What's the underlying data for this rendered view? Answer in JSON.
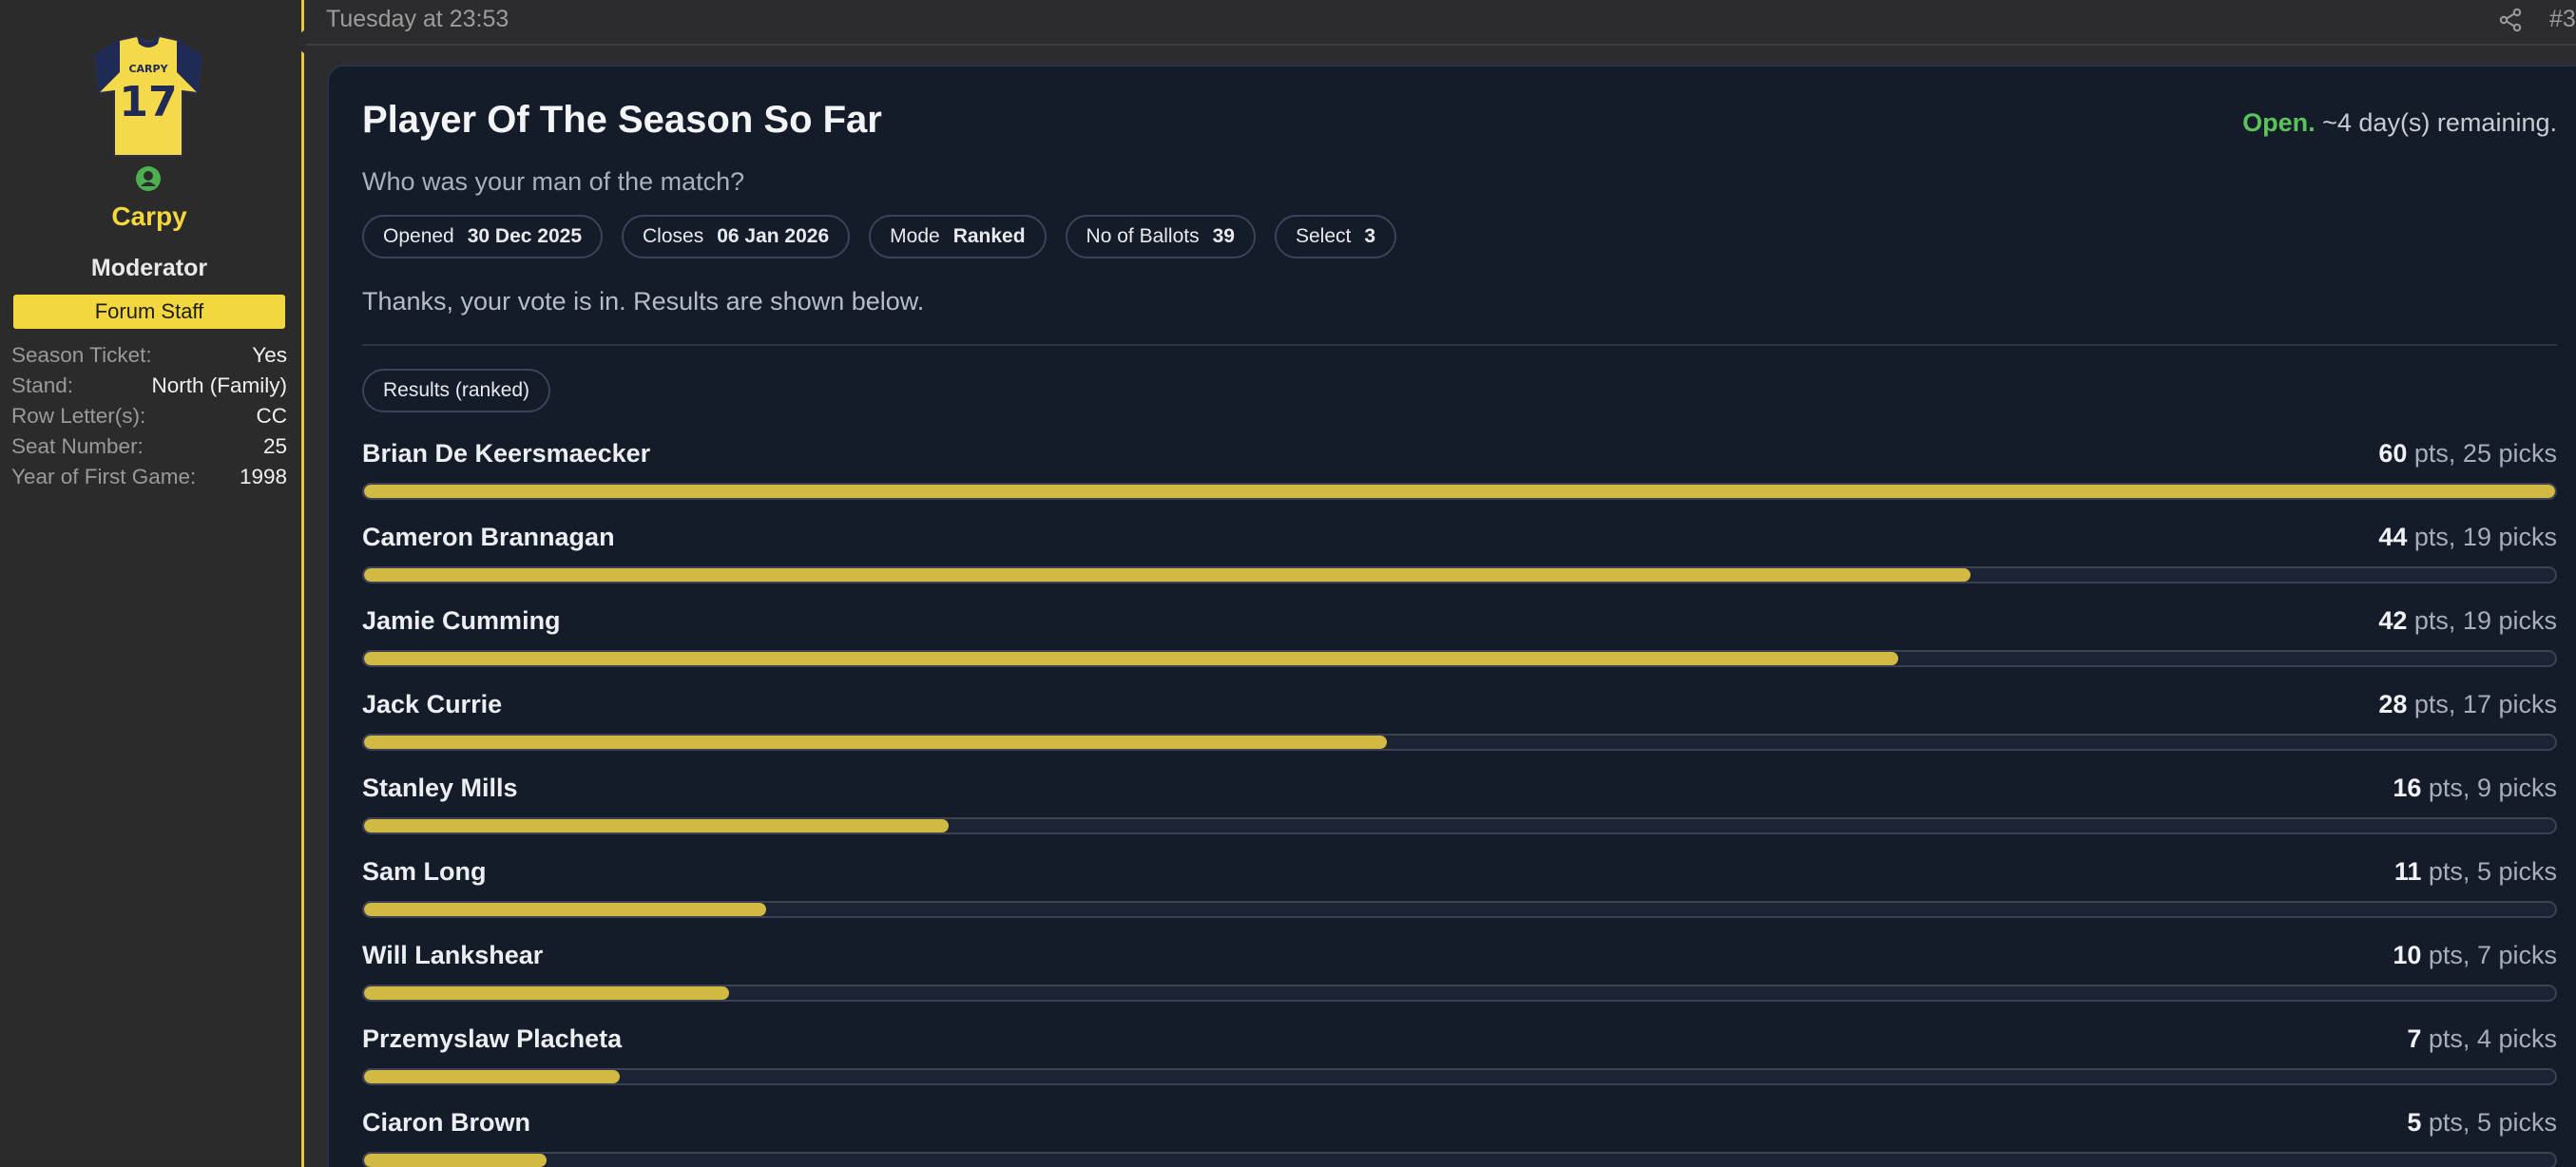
{
  "user": {
    "jersey_name": "CARPY",
    "jersey_number": "17",
    "name": "Carpy",
    "title": "Moderator",
    "banner": "Forum Staff",
    "fields": [
      {
        "label": "Season Ticket:",
        "value": "Yes"
      },
      {
        "label": "Stand:",
        "value": "North (Family)"
      },
      {
        "label": "Row Letter(s):",
        "value": "CC"
      },
      {
        "label": "Seat Number:",
        "value": "25"
      },
      {
        "label": "Year of First Game:",
        "value": "1998"
      }
    ]
  },
  "post": {
    "timestamp": "Tuesday at 23:53",
    "number": "#3"
  },
  "poll": {
    "title": "Player Of The Season So Far",
    "status_open": "Open.",
    "status_remaining": "~4 day(s) remaining.",
    "question": "Who was your man of the match?",
    "chips": [
      {
        "key": "Opened",
        "value": "30 Dec 2025"
      },
      {
        "key": "Closes",
        "value": "06 Jan 2026"
      },
      {
        "key": "Mode",
        "value": "Ranked"
      },
      {
        "key": "No of Ballots",
        "value": "39"
      },
      {
        "key": "Select",
        "value": "3"
      }
    ],
    "thanks": "Thanks, your vote is in. Results are shown below.",
    "results_label": "Results (ranked)",
    "pts_unit": " pts, ",
    "picks_unit": " picks",
    "max_points": 60,
    "results": [
      {
        "name": "Brian De Keersmaecker",
        "points": "60",
        "picks": "25"
      },
      {
        "name": "Cameron Brannagan",
        "points": "44",
        "picks": "19"
      },
      {
        "name": "Jamie Cumming",
        "points": "42",
        "picks": "19"
      },
      {
        "name": "Jack Currie",
        "points": "28",
        "picks": "17"
      },
      {
        "name": "Stanley Mills",
        "points": "16",
        "picks": "9"
      },
      {
        "name": "Sam Long",
        "points": "11",
        "picks": "5"
      },
      {
        "name": "Will Lankshear",
        "points": "10",
        "picks": "7"
      },
      {
        "name": "Przemyslaw Placheta",
        "points": "7",
        "picks": "4"
      },
      {
        "name": "Ciaron Brown",
        "points": "5",
        "picks": "5"
      }
    ]
  },
  "colors": {
    "accent_yellow": "#f2d83e",
    "bar_fill": "#d2b943",
    "open_green": "#5cc35a",
    "card_bg": "#141b29"
  },
  "icons": [
    "jersey-avatar-icon",
    "online-status-icon",
    "share-icon"
  ]
}
